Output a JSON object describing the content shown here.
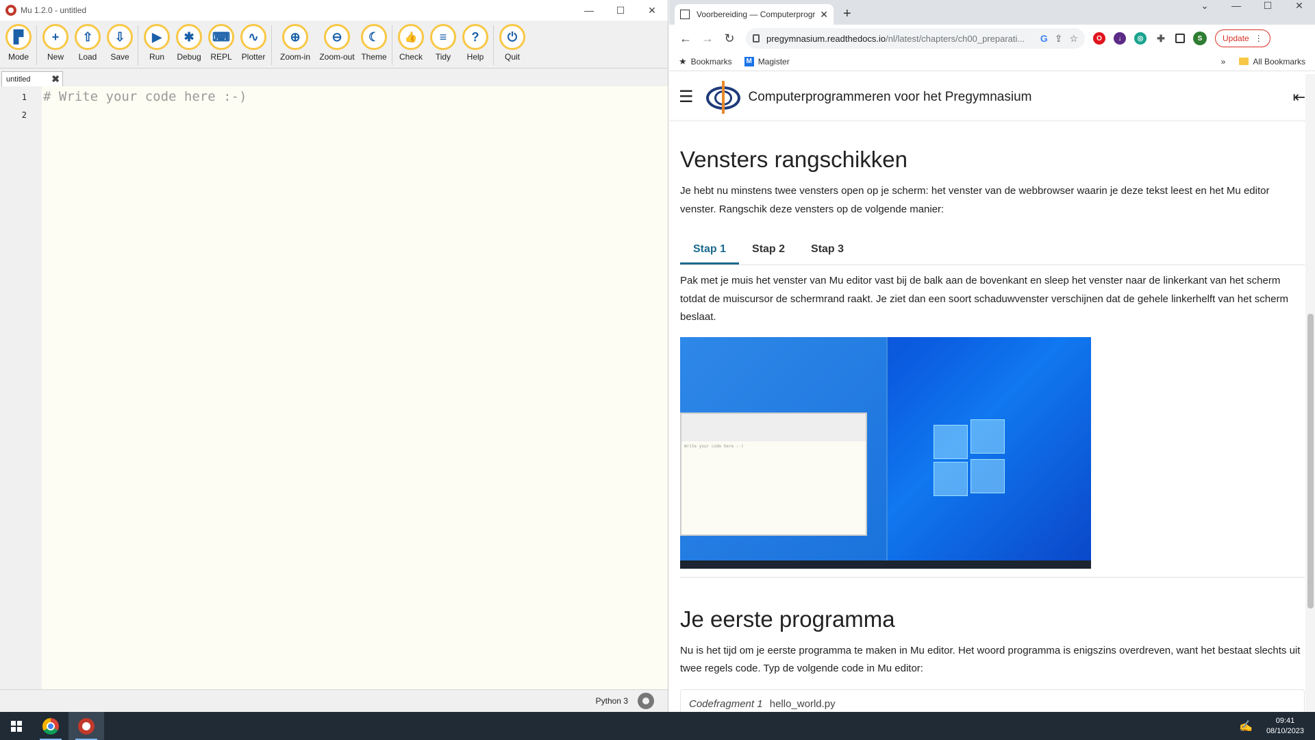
{
  "mu": {
    "title": "Mu 1.2.0 - untitled",
    "toolbar": [
      {
        "label": "Mode",
        "icon": "mode-icon",
        "glyph": "▛"
      },
      {
        "label": "New",
        "icon": "plus-icon",
        "glyph": "+"
      },
      {
        "label": "Load",
        "icon": "upload-icon",
        "glyph": "⇧"
      },
      {
        "label": "Save",
        "icon": "download-icon",
        "glyph": "⇩"
      },
      {
        "label": "Run",
        "icon": "play-icon",
        "glyph": "▶"
      },
      {
        "label": "Debug",
        "icon": "bug-icon",
        "glyph": "✱"
      },
      {
        "label": "REPL",
        "icon": "keyboard-icon",
        "glyph": "⌨"
      },
      {
        "label": "Plotter",
        "icon": "pulse-icon",
        "glyph": "∿"
      },
      {
        "label": "Zoom-in",
        "icon": "zoom-in-icon",
        "glyph": "⊕"
      },
      {
        "label": "Zoom-out",
        "icon": "zoom-out-icon",
        "glyph": "⊖"
      },
      {
        "label": "Theme",
        "icon": "moon-icon",
        "glyph": "☾"
      },
      {
        "label": "Check",
        "icon": "thumbs-up-icon",
        "glyph": "👍"
      },
      {
        "label": "Tidy",
        "icon": "lines-icon",
        "glyph": "≡"
      },
      {
        "label": "Help",
        "icon": "question-icon",
        "glyph": "?"
      },
      {
        "label": "Quit",
        "icon": "power-icon",
        "glyph": "⏻"
      }
    ],
    "tab_label": "untitled",
    "line_numbers": [
      "1",
      "2"
    ],
    "code_line_1": "# Write your code here :-)",
    "mode_status": "Python 3",
    "accent": "#f8c744"
  },
  "browser": {
    "tab_title": "Voorbereiding — Computerprogrammeren",
    "url_host": "pregymnasium.readthedocs.io",
    "url_path": "/nl/latest/chapters/ch00_preparati...",
    "update_label": "Update",
    "profile_initial": "S",
    "bookmarks": {
      "bookmarks_label": "Bookmarks",
      "magister_label": "Magister",
      "all_label": "All Bookmarks",
      "overflow": "»"
    }
  },
  "page": {
    "site_title": "Computerprogrammeren voor het Pregymnasium",
    "heading1": "Vensters rangschikken",
    "para1": "Je hebt nu minstens twee vensters open op je scherm: het venster van de webbrowser waarin je deze tekst leest en het Mu editor venster. Rangschik deze vensters op de volgende manier:",
    "tabs": [
      "Stap 1",
      "Stap 2",
      "Stap 3"
    ],
    "para2": "Pak met je muis het venster van Mu editor vast bij de balk aan de bovenkant en sleep het venster naar de linkerkant van het scherm totdat de muiscursor de schermrand raakt. Je ziet dan een soort schaduwvenster verschijnen dat de gehele linkerhelft van het scherm beslaat.",
    "heading2": "Je eerste programma",
    "para3": "Nu is het tijd om je eerste programma te maken in Mu editor. Het woord programma is enigszins overdreven, want het bestaat slechts uit twee regels code. Typ de volgende code in Mu editor:",
    "code_caption": "Codefragment 1",
    "code_file": "hello_world.py",
    "accent": "#1c6a8c"
  },
  "taskbar": {
    "time": "09:41",
    "date": "08/10/2023"
  }
}
